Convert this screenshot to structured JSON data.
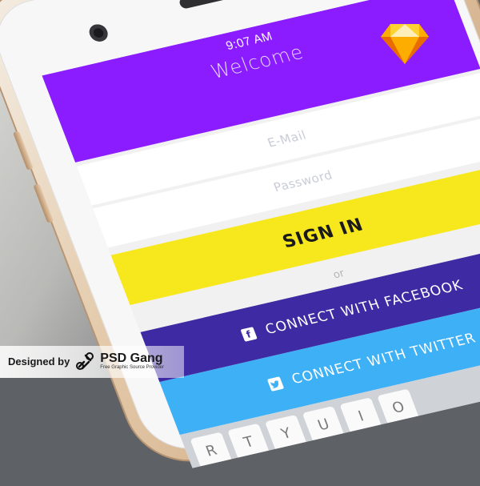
{
  "status_bar": {
    "time": "9:07 AM"
  },
  "header": {
    "title": "Welcome"
  },
  "form": {
    "email_placeholder": "E-Mail",
    "password_placeholder": "Password",
    "signin_label": "SIGN IN",
    "or_label": "or",
    "facebook_label": "CONNECT WITH FACEBOOK",
    "twitter_label": "CONNECT WITH TWITTER"
  },
  "keyboard": {
    "keys": [
      "R",
      "T",
      "Y",
      "U",
      "I",
      "O"
    ]
  },
  "credit": {
    "designed_by": "Designed by",
    "brand": "PSD Gang",
    "tagline": "Free Graphic Source Provider"
  },
  "colors": {
    "header": "#8a1cff",
    "signin": "#f7e81d",
    "facebook": "#3e2aa3",
    "twitter": "#3eb0f5"
  },
  "icons": [
    "sketch-logo-icon",
    "facebook-icon",
    "twitter-icon",
    "psd-gang-logo-icon"
  ]
}
